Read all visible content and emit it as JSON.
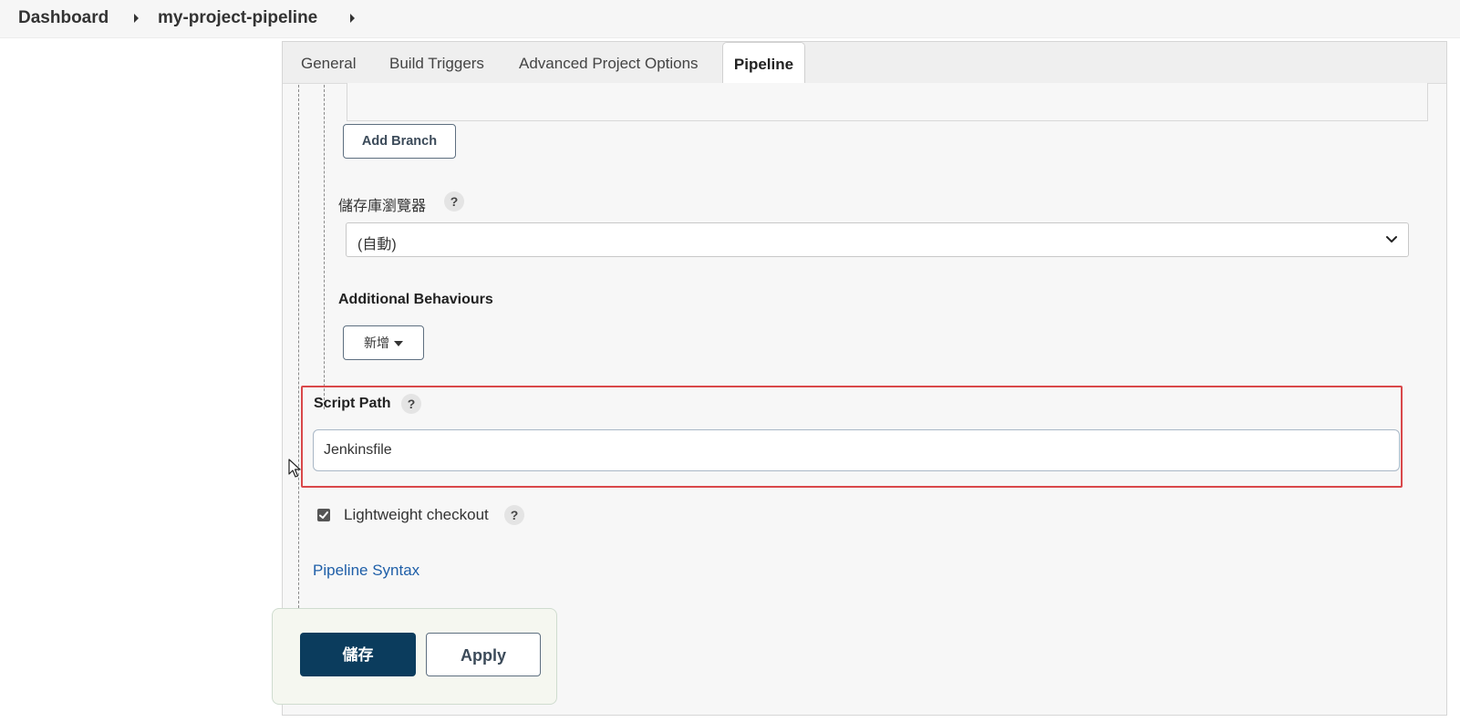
{
  "breadcrumb": {
    "items": [
      "Dashboard",
      "my-project-pipeline"
    ]
  },
  "tabs": [
    {
      "label": "General",
      "active": false
    },
    {
      "label": "Build Triggers",
      "active": false
    },
    {
      "label": "Advanced Project Options",
      "active": false
    },
    {
      "label": "Pipeline",
      "active": true
    }
  ],
  "scm": {
    "add_branch_label": "Add Branch",
    "repo_browser": {
      "label": "儲存庫瀏覽器",
      "help": "?",
      "selected": "(自動)"
    },
    "additional_behaviours": {
      "label": "Additional Behaviours",
      "add_label": "新增"
    }
  },
  "script_path": {
    "label": "Script Path",
    "help": "?",
    "value": "Jenkinsfile"
  },
  "lightweight_checkout": {
    "label": "Lightweight checkout",
    "help": "?",
    "checked": true
  },
  "pipeline_syntax_link": "Pipeline Syntax",
  "actions": {
    "save_label": "儲存",
    "apply_label": "Apply"
  },
  "colors": {
    "primary_button": "#0b3c5d",
    "highlight_frame": "#d9484a",
    "link": "#1f5fa8"
  }
}
